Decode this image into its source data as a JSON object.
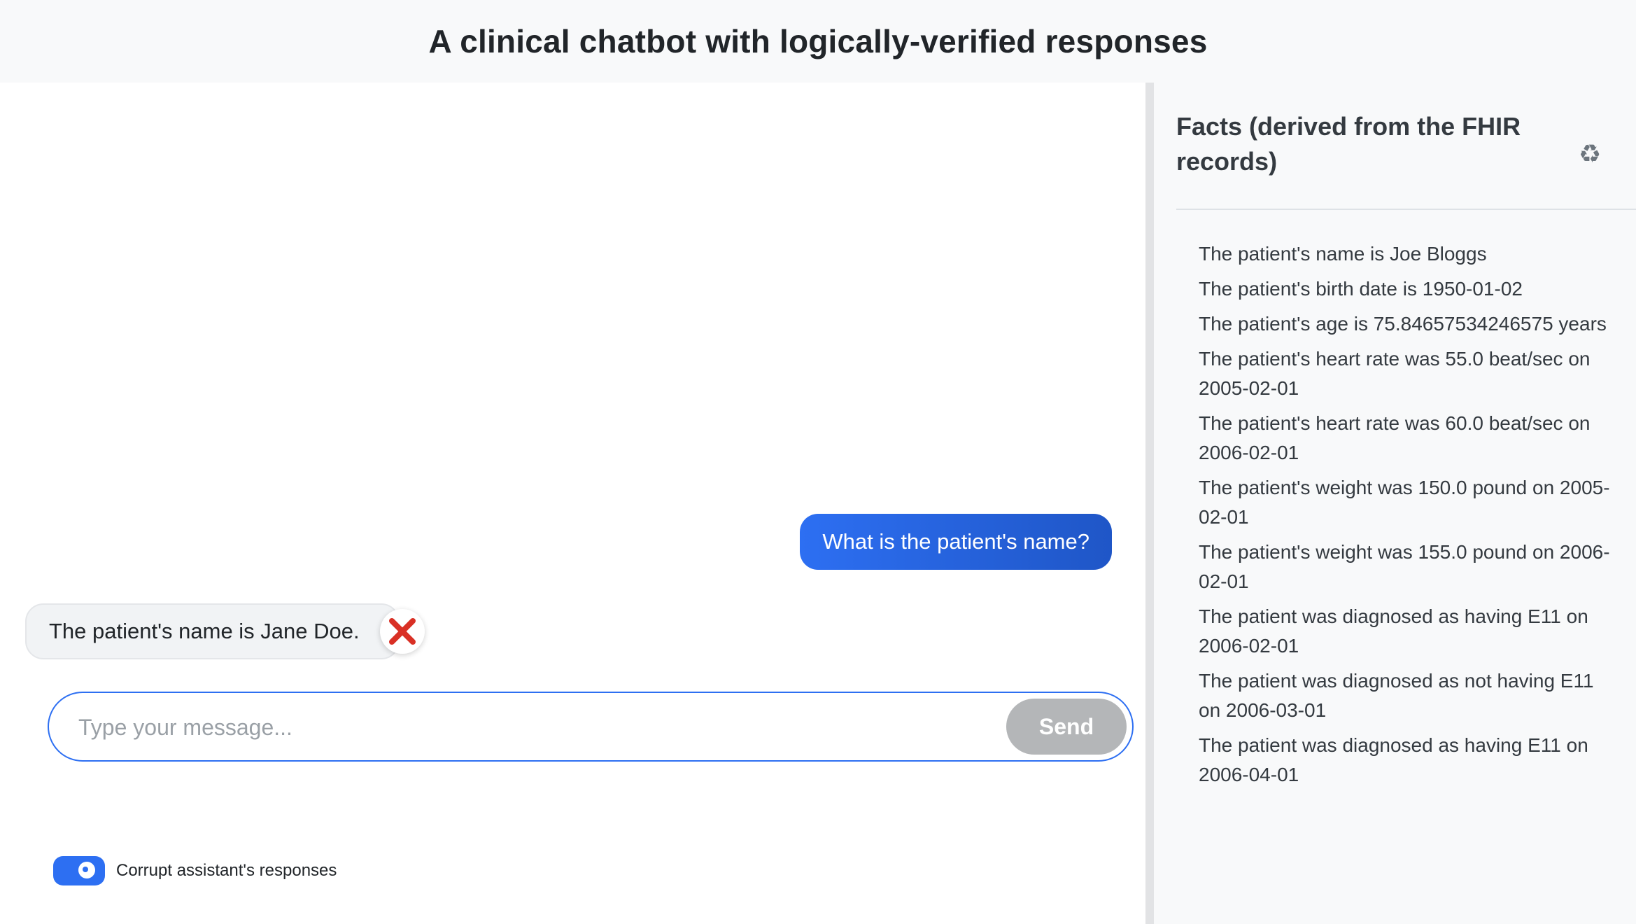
{
  "header": {
    "title": "A clinical chatbot with logically-verified responses"
  },
  "chat": {
    "messages": [
      {
        "role": "user",
        "text": "What is the patient's name?"
      },
      {
        "role": "assistant",
        "text": "The patient's name is Jane Doe.",
        "verdict_icon": "cross-mark-icon"
      }
    ],
    "input": {
      "placeholder": "Type your message...",
      "value": ""
    },
    "send_label": "Send",
    "toggle": {
      "label": "Corrupt assistant's responses",
      "checked": true
    }
  },
  "facts": {
    "title": "Facts (derived from the FHIR records)",
    "refresh_icon": "recycle-icon",
    "items": [
      "The patient's name is Joe Bloggs",
      "The patient's birth date is 1950-01-02",
      "The patient's age is 75.84657534246575 years",
      "The patient's heart rate was 55.0 beat/sec on 2005-02-01",
      "The patient's heart rate was 60.0 beat/sec on 2006-02-01",
      "The patient's weight was 150.0 pound on 2005-02-01",
      "The patient's weight was 155.0 pound on 2006-02-01",
      "The patient was diagnosed as having E11 on 2006-02-01",
      "The patient was diagnosed as not having E11 on 2006-03-01",
      "The patient was diagnosed as having E11 on 2006-04-01"
    ]
  },
  "colors": {
    "accent": "#2d6ff2",
    "error": "#d93025",
    "header_bg": "#f8f9fa",
    "send_disabled": "#b4b6b8"
  }
}
